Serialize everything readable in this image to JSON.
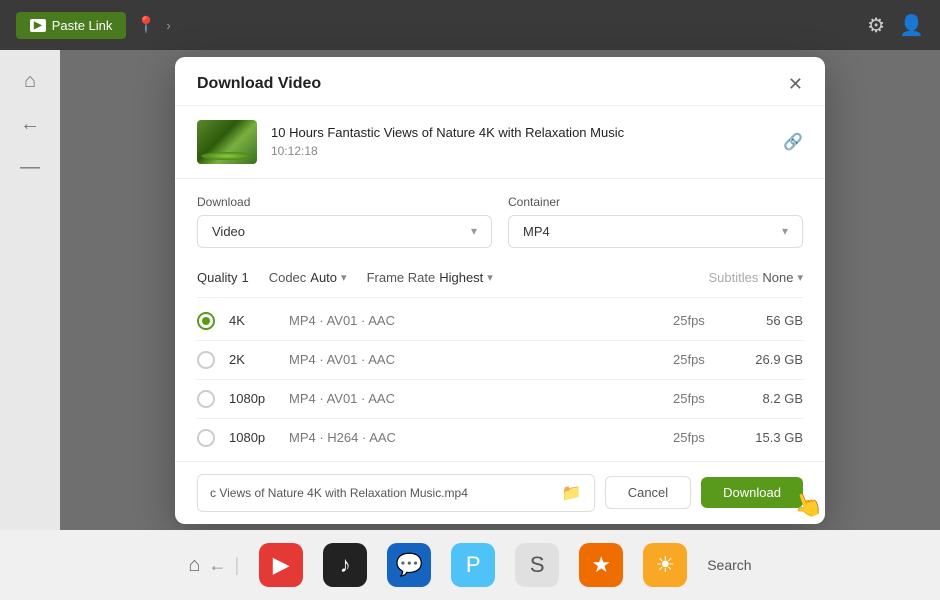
{
  "topbar": {
    "paste_link_label": "Paste Link",
    "yt_icon_label": "▶",
    "settings_icon": "⚙",
    "user_icon": "👤"
  },
  "modal": {
    "title": "Download Video",
    "close_icon": "✕",
    "video": {
      "title": "10 Hours Fantastic Views of Nature 4K with Relaxation Music",
      "duration": "10:12:18"
    },
    "download_label": "Download",
    "download_value": "Video",
    "container_label": "Container",
    "container_value": "MP4",
    "quality_label": "Quality",
    "quality_num": "1",
    "codec_label": "Codec",
    "codec_value": "Auto",
    "frame_rate_label": "Frame Rate",
    "frame_rate_value": "Highest",
    "subtitles_label": "Subtitles",
    "subtitles_value": "None",
    "resolutions": [
      {
        "name": "4K",
        "codec": "MP4 · AV01 · AAC",
        "fps": "25fps",
        "size": "56 GB",
        "selected": true
      },
      {
        "name": "2K",
        "codec": "MP4 · AV01 · AAC",
        "fps": "25fps",
        "size": "26.9 GB",
        "selected": false
      },
      {
        "name": "1080p",
        "codec": "MP4 · AV01 · AAC",
        "fps": "25fps",
        "size": "8.2 GB",
        "selected": false
      },
      {
        "name": "1080p",
        "codec": "MP4 · H264 · AAC",
        "fps": "25fps",
        "size": "15.3 GB",
        "selected": false
      }
    ],
    "filename": "c Views of Nature 4K with Relaxation Music.mp4",
    "cancel_label": "Cancel",
    "download_btn_label": "Download"
  },
  "taskbar": {
    "icons": [
      "🏠",
      "🔴",
      "⬛",
      "🔵",
      "🟣",
      "🟢",
      "🟠",
      "🟡"
    ],
    "search_label": "Search"
  }
}
